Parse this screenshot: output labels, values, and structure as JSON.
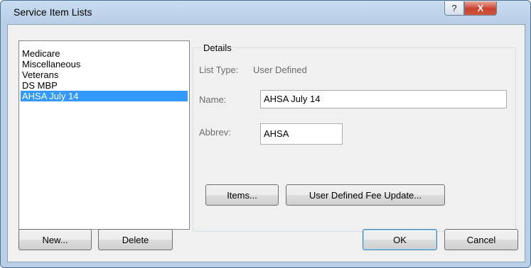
{
  "window": {
    "title": "Service Item Lists"
  },
  "titlebar": {
    "help_glyph": "?",
    "close_glyph": "X"
  },
  "list": {
    "items": [
      "Medicare",
      "Miscellaneous",
      "Veterans",
      "DS MBP",
      "AHSA July 14"
    ],
    "selected": "AHSA July 14"
  },
  "details": {
    "legend": "Details",
    "list_type_label": "List Type:",
    "list_type_value": "User Defined",
    "name_label": "Name:",
    "name_value": "AHSA July 14",
    "abbrev_label": "Abbrev:",
    "abbrev_value": "AHSA",
    "items_button": "Items...",
    "fee_update_button": "User Defined Fee Update..."
  },
  "footer": {
    "new_button": "New...",
    "delete_button": "Delete",
    "ok_button": "OK",
    "cancel_button": "Cancel"
  },
  "colors": {
    "selection": "#3399ff",
    "frame": "#b9cfe8",
    "close": "#c8412c"
  }
}
